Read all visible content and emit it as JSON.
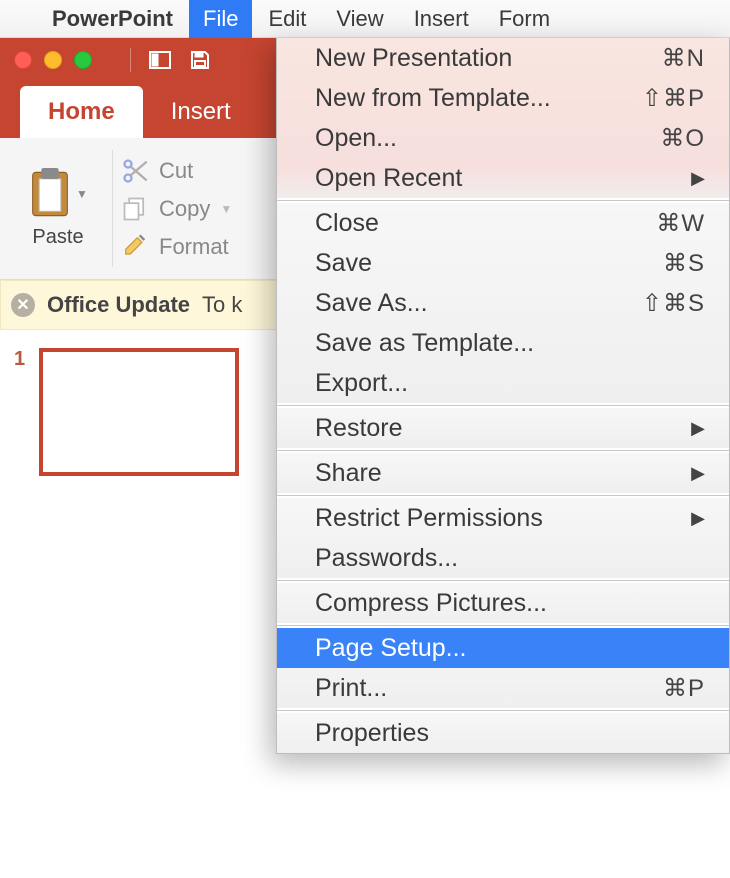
{
  "menubar": {
    "app_name": "PowerPoint",
    "file": "File",
    "edit": "Edit",
    "view": "View",
    "insert": "Insert",
    "format": "Form"
  },
  "ribbon_tabs": {
    "home": "Home",
    "insert": "Insert"
  },
  "ribbon": {
    "paste": "Paste",
    "cut": "Cut",
    "copy": "Copy",
    "format": "Format"
  },
  "update_bar": {
    "title": "Office Update",
    "body": "To k"
  },
  "slides": {
    "current_number": "1"
  },
  "file_menu": {
    "new_presentation": {
      "label": "New Presentation",
      "shortcut": "⌘N"
    },
    "new_from_template": {
      "label": "New from Template...",
      "shortcut": "⇧⌘P"
    },
    "open": {
      "label": "Open...",
      "shortcut": "⌘O"
    },
    "open_recent": {
      "label": "Open Recent"
    },
    "close": {
      "label": "Close",
      "shortcut": "⌘W"
    },
    "save": {
      "label": "Save",
      "shortcut": "⌘S"
    },
    "save_as": {
      "label": "Save As...",
      "shortcut": "⇧⌘S"
    },
    "save_as_template": {
      "label": "Save as Template..."
    },
    "export": {
      "label": "Export..."
    },
    "restore": {
      "label": "Restore"
    },
    "share": {
      "label": "Share"
    },
    "restrict_permissions": {
      "label": "Restrict Permissions"
    },
    "passwords": {
      "label": "Passwords..."
    },
    "compress_pictures": {
      "label": "Compress Pictures..."
    },
    "page_setup": {
      "label": "Page Setup..."
    },
    "print": {
      "label": "Print...",
      "shortcut": "⌘P"
    },
    "properties": {
      "label": "Properties"
    }
  }
}
